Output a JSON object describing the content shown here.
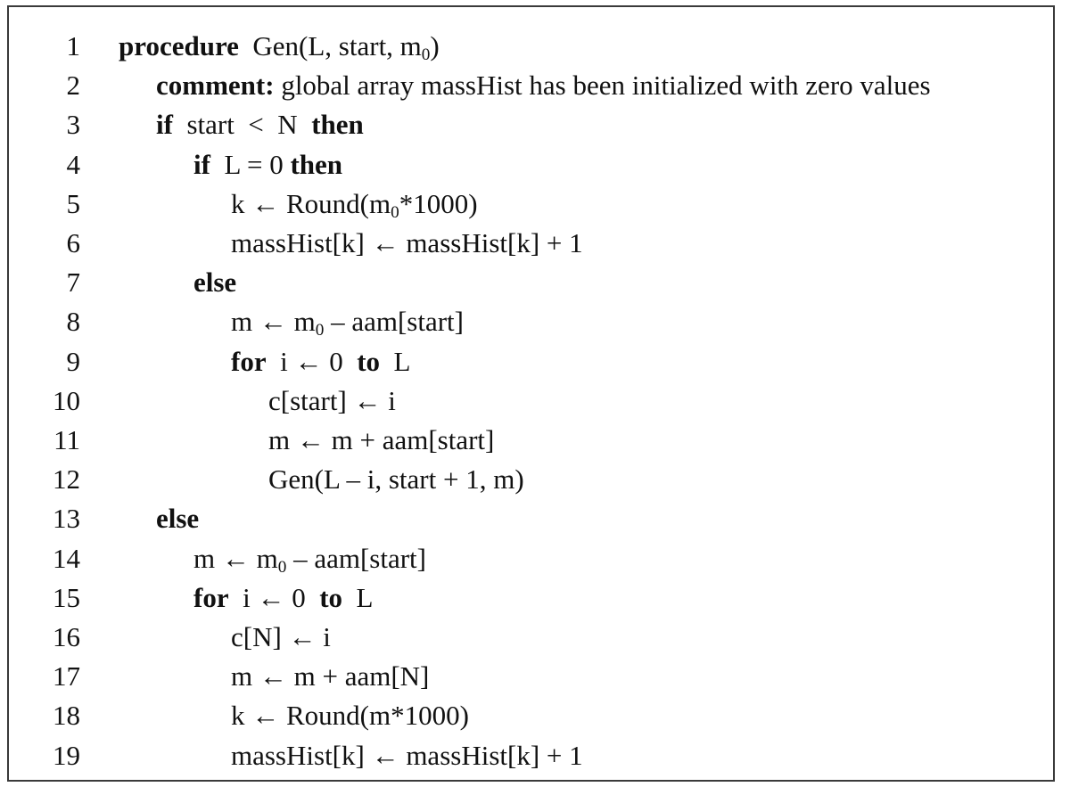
{
  "algorithm": {
    "lines": [
      {
        "n": "1",
        "indent": 0,
        "parts": [
          {
            "t": "procedure",
            "b": true
          },
          {
            "t": "  Gen(L, start, m"
          },
          {
            "t": "0",
            "sub": true
          },
          {
            "t": ")"
          }
        ]
      },
      {
        "n": "2",
        "indent": 1,
        "parts": [
          {
            "t": "comment:",
            "b": true
          },
          {
            "t": " global array massHist has been initialized with zero values"
          }
        ]
      },
      {
        "n": "3",
        "indent": 1,
        "parts": [
          {
            "t": "if",
            "b": true
          },
          {
            "t": "  start  <  N  "
          },
          {
            "t": "then",
            "b": true
          }
        ]
      },
      {
        "n": "4",
        "indent": 2,
        "parts": [
          {
            "t": "if",
            "b": true
          },
          {
            "t": "  L = 0 "
          },
          {
            "t": "then",
            "b": true
          }
        ]
      },
      {
        "n": "5",
        "indent": 3,
        "parts": [
          {
            "t": "k ← Round(m"
          },
          {
            "t": "0",
            "sub": true
          },
          {
            "t": "*1000)"
          }
        ]
      },
      {
        "n": "6",
        "indent": 3,
        "parts": [
          {
            "t": "massHist[k] ← massHist[k] + 1"
          }
        ]
      },
      {
        "n": "7",
        "indent": 2,
        "parts": [
          {
            "t": "else",
            "b": true
          }
        ]
      },
      {
        "n": "8",
        "indent": 3,
        "parts": [
          {
            "t": "m ← m"
          },
          {
            "t": "0",
            "sub": true
          },
          {
            "t": " – aam[start]"
          }
        ]
      },
      {
        "n": "9",
        "indent": 3,
        "parts": [
          {
            "t": "for",
            "b": true
          },
          {
            "t": "  i ← 0  "
          },
          {
            "t": "to",
            "b": true
          },
          {
            "t": "  L"
          }
        ]
      },
      {
        "n": "10",
        "indent": 4,
        "parts": [
          {
            "t": "c[start] ← i"
          }
        ]
      },
      {
        "n": "11",
        "indent": 4,
        "parts": [
          {
            "t": "m ← m + aam[start]"
          }
        ]
      },
      {
        "n": "12",
        "indent": 4,
        "parts": [
          {
            "t": "Gen(L – i, start + 1, m)"
          }
        ]
      },
      {
        "n": "13",
        "indent": 1,
        "parts": [
          {
            "t": "else",
            "b": true
          }
        ]
      },
      {
        "n": "14",
        "indent": 2,
        "parts": [
          {
            "t": "m ← m"
          },
          {
            "t": "0",
            "sub": true
          },
          {
            "t": " – aam[start]"
          }
        ]
      },
      {
        "n": "15",
        "indent": 2,
        "parts": [
          {
            "t": "for",
            "b": true
          },
          {
            "t": "  i ← 0  "
          },
          {
            "t": "to",
            "b": true
          },
          {
            "t": "  L"
          }
        ]
      },
      {
        "n": "16",
        "indent": 3,
        "parts": [
          {
            "t": "c[N] ← i"
          }
        ]
      },
      {
        "n": "17",
        "indent": 3,
        "parts": [
          {
            "t": "m ← m + aam[N]"
          }
        ]
      },
      {
        "n": "18",
        "indent": 3,
        "parts": [
          {
            "t": "k ← Round(m*1000)"
          }
        ]
      },
      {
        "n": "19",
        "indent": 3,
        "parts": [
          {
            "t": "massHist[k] ← massHist[k] + 1"
          }
        ]
      }
    ]
  }
}
